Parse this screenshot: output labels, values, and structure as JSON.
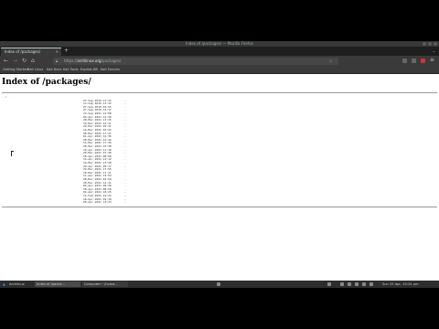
{
  "window": {
    "title": "Index of /packages/ — Mozilla Firefox"
  },
  "tabs": [
    {
      "label": "Index of /packages/"
    }
  ],
  "nav": {
    "url_prefix": "https://",
    "url_host": "archlinux.org",
    "url_path": "/packages/"
  },
  "bookmarks": [
    "Getting Started",
    "Kali Linux",
    "Kali Docs",
    "Kali Tools",
    "Exploit-DB",
    "Kali Forums",
    "NetHunter",
    "Offensive Security"
  ],
  "listing": {
    "title": "Index of /packages/",
    "parent": "../",
    "rows": [
      {
        "date": "27-Sep-2019 13:32",
        "size": "-"
      },
      {
        "date": "13-Sep-2019 13:32",
        "size": "-"
      },
      {
        "date": "27-Sep-2019 04:55",
        "size": "-"
      },
      {
        "date": "27-Sep-2019 14:17",
        "size": "-"
      },
      {
        "date": "13-Sep-2021 12:08",
        "size": "-"
      },
      {
        "date": "04-Apr-2021 12:30",
        "size": "-"
      },
      {
        "date": "28-Mar-2021 13:15",
        "size": "-"
      },
      {
        "date": "19-Mar-2021 14:11",
        "size": "-"
      },
      {
        "date": "29-Mar-2021 09:11",
        "size": "-"
      },
      {
        "date": "14-Mar-2021 02:22",
        "size": "-"
      },
      {
        "date": "28-Mar-2021 17:47",
        "size": "-"
      },
      {
        "date": "01-Apr-2021 12:36",
        "size": "-"
      },
      {
        "date": "28-Mar-2021 12:42",
        "size": "-"
      },
      {
        "date": "14-Mar-2021 17:39",
        "size": "-"
      },
      {
        "date": "28-Mar-2021 15:38",
        "size": "-"
      },
      {
        "date": "18-Apr-2021 11:10",
        "size": "-"
      },
      {
        "date": "28-Mar-2021 07:48",
        "size": "-"
      },
      {
        "date": "18-Apr-2021 08:09",
        "size": "-"
      },
      {
        "date": "14-Apr-2021 14:12",
        "size": "-"
      },
      {
        "date": "19-Mar-2021 13:28",
        "size": "-"
      },
      {
        "date": "20-Apr-2021 09:17",
        "size": "-"
      },
      {
        "date": "29-Mar-2021 17:55",
        "size": "-"
      },
      {
        "date": "18-Mar-2021 11:11",
        "size": "-"
      },
      {
        "date": "11-Apr-2021 14:53",
        "size": "-"
      },
      {
        "date": "28-Mar-2021 02:54",
        "size": "-"
      },
      {
        "date": "28-Mar-2021 14:11",
        "size": "-"
      },
      {
        "date": "04-Apr-2021 09:36",
        "size": "-"
      },
      {
        "date": "18-Apr-2021 08:56",
        "size": "-"
      },
      {
        "date": "04-Apr-2021 18:25",
        "size": "-"
      },
      {
        "date": "12-Feb-2021 19:23",
        "size": "-"
      },
      {
        "date": "18-Apr-2021 02:16",
        "size": "-"
      },
      {
        "date": "08-Apr-2021 13:23",
        "size": "-"
      }
    ]
  },
  "taskbar": {
    "apps_label": "Archlinux",
    "tasks": [
      "Index of /packa...",
      "Computer:~/home..."
    ],
    "clock": "Sun 25 Apr, 10:24 pm"
  }
}
